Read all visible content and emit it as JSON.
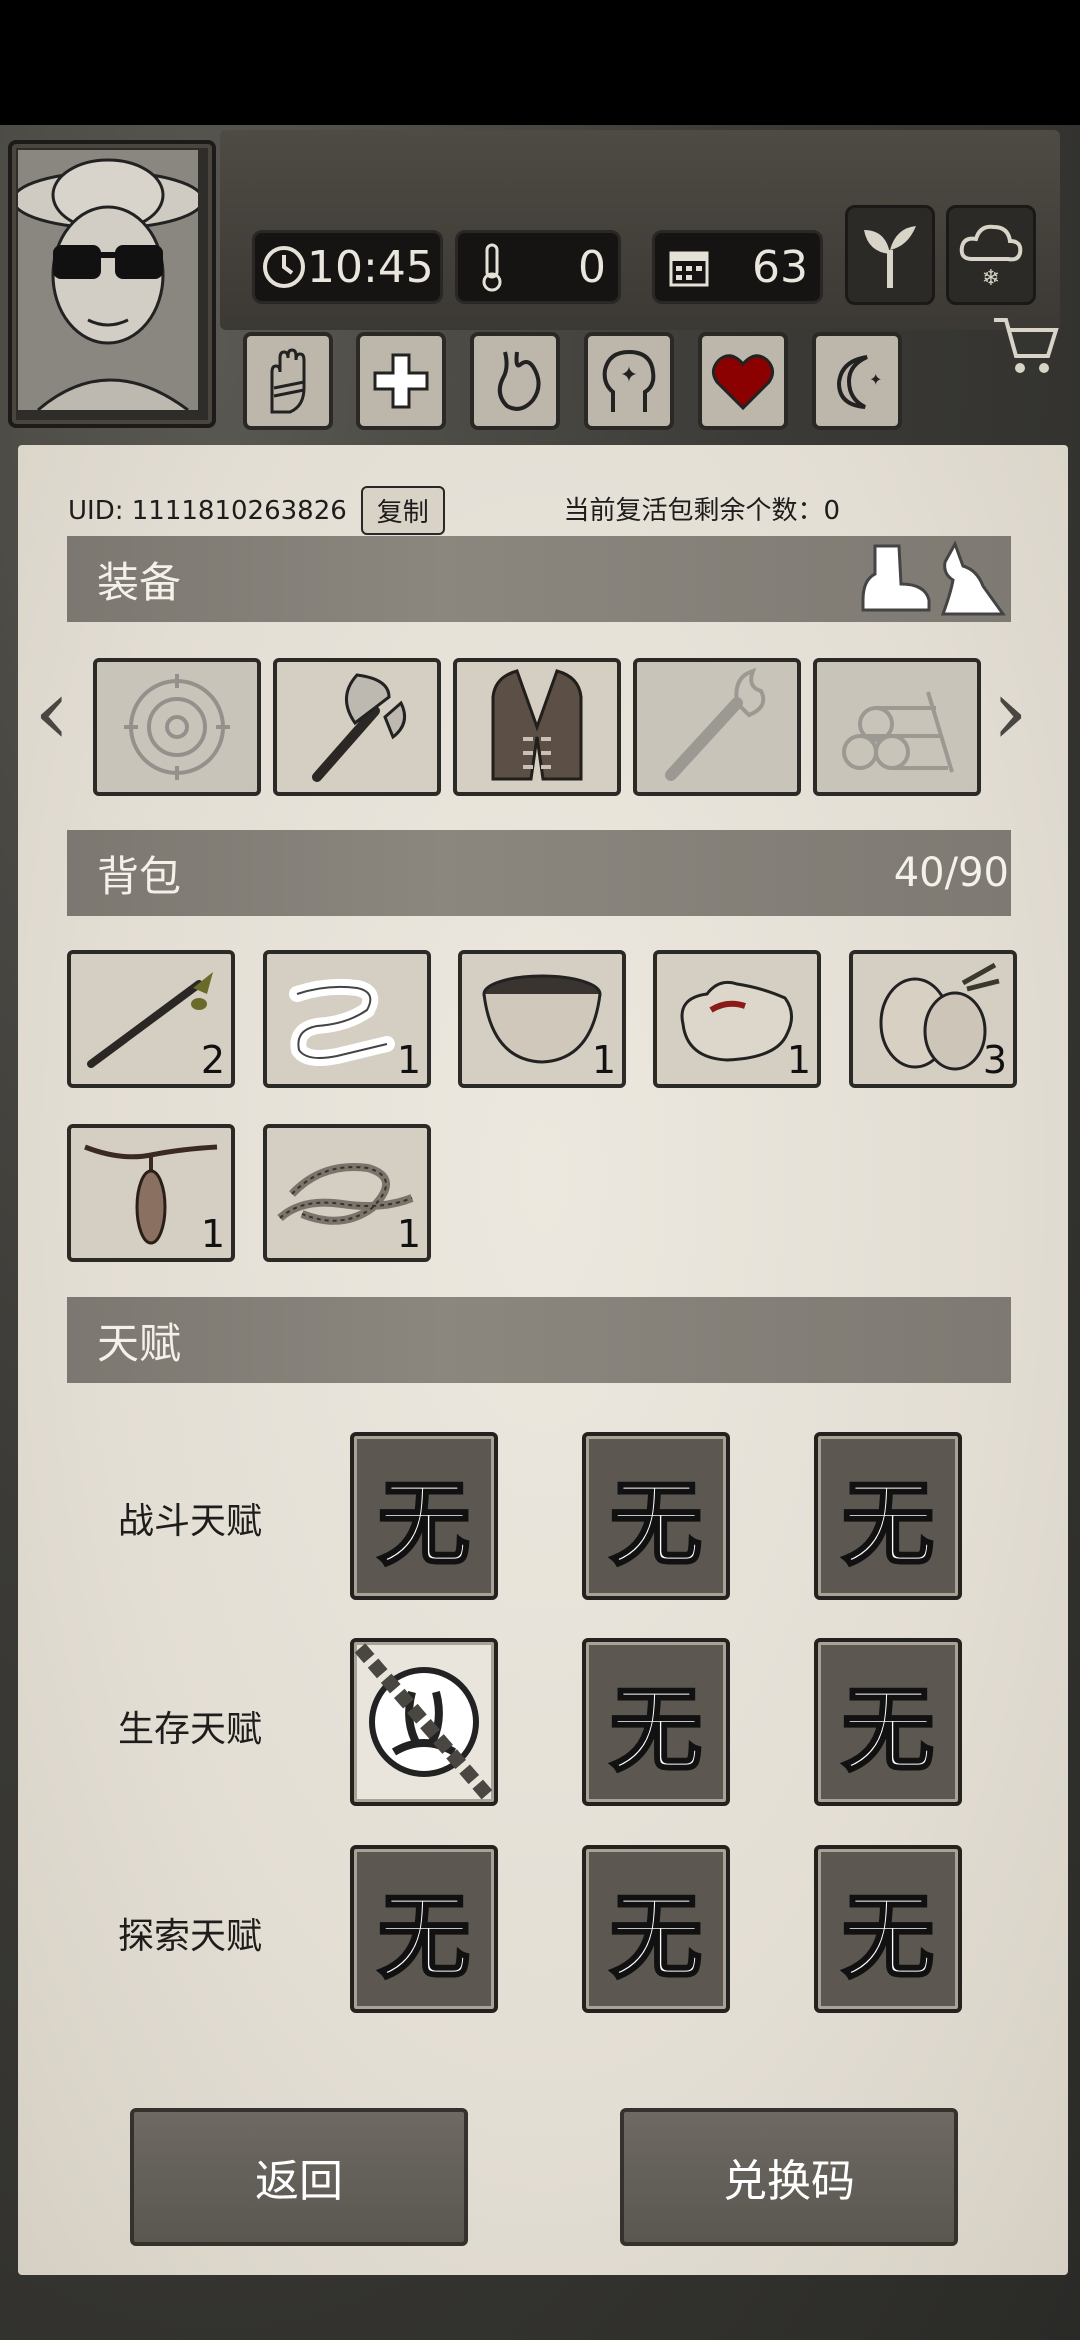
{
  "hud": {
    "time": "10:45",
    "temperature": "0",
    "days": "63"
  },
  "account": {
    "uid": "UID: 1111810263826",
    "copy_label": "复制",
    "revive_text": "当前复活包剩余个数：0"
  },
  "equipment": {
    "title": "装备",
    "slots": [
      "target-slot",
      "axe",
      "vest",
      "torch",
      "logs"
    ]
  },
  "backpack": {
    "title": "背包",
    "capacity": "40/90",
    "items": [
      {
        "icon": "spear-icon",
        "qty": "2"
      },
      {
        "icon": "bandage-icon",
        "qty": "1"
      },
      {
        "icon": "bowl-icon",
        "qty": "1"
      },
      {
        "icon": "meat-icon",
        "qty": "1"
      },
      {
        "icon": "coconut-icon",
        "qty": "3"
      },
      {
        "icon": "pendant-icon",
        "qty": "1"
      },
      {
        "icon": "rope-icon",
        "qty": "1"
      }
    ]
  },
  "talents": {
    "title": "天赋",
    "none_glyph": "无",
    "rows": [
      {
        "label": "战斗天赋"
      },
      {
        "label": "生存天赋"
      },
      {
        "label": "探索天赋"
      }
    ]
  },
  "buttons": {
    "back": "返回",
    "redeem": "兑换码"
  },
  "colors": {
    "section_bar": "#85817a",
    "paper": "#e8e4db",
    "heart": "#8b0000"
  }
}
